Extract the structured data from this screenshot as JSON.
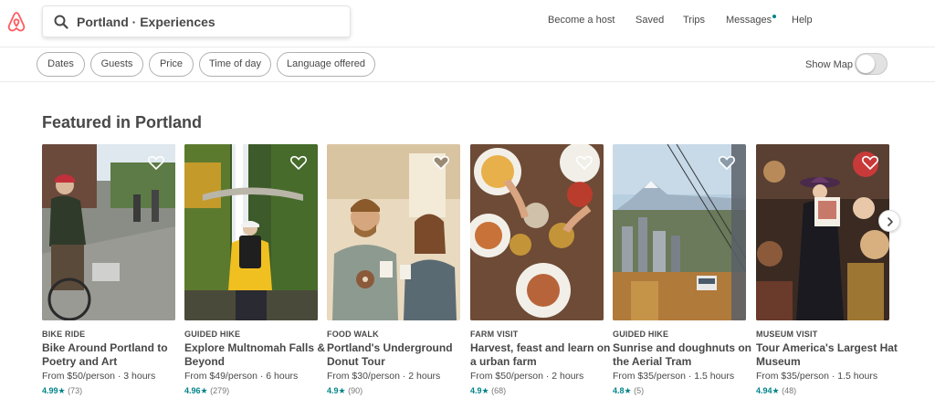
{
  "search": {
    "value": "Portland · Experiences"
  },
  "nav": {
    "become_host": "Become a host",
    "saved": "Saved",
    "trips": "Trips",
    "messages": "Messages",
    "help": "Help"
  },
  "filters": [
    "Dates",
    "Guests",
    "Price",
    "Time of day",
    "Language offered"
  ],
  "show_map": "Show Map",
  "section_title": "Featured in Portland",
  "cards": [
    {
      "category": "BIKE RIDE",
      "title": "Bike Around Portland to Poetry and Art",
      "price": "From $50/person · 3 hours",
      "score": "4.99",
      "star": "★",
      "count": "(73)"
    },
    {
      "category": "GUIDED HIKE",
      "title": "Explore Multnomah Falls & Beyond",
      "price": "From $49/person · 6 hours",
      "score": "4.96",
      "star": "★",
      "count": "(279)"
    },
    {
      "category": "FOOD WALK",
      "title": "Portland's Underground Donut Tour",
      "price": "From $30/person · 2 hours",
      "score": "4.9",
      "star": "★",
      "count": "(90)"
    },
    {
      "category": "FARM VISIT",
      "title": "Harvest, feast and learn on a urban farm",
      "price": "From $50/person · 2 hours",
      "score": "4.9",
      "star": "★",
      "count": "(68)"
    },
    {
      "category": "GUIDED HIKE",
      "title": "Sunrise and doughnuts on the Aerial Tram",
      "price": "From $35/person · 1.5 hours",
      "score": "4.8",
      "star": "★",
      "count": "(5)"
    },
    {
      "category": "MUSEUM VISIT",
      "title": "Tour America's Largest Hat Museum",
      "price": "From $35/person · 1.5 hours",
      "score": "4.94",
      "star": "★",
      "count": "(48)"
    }
  ],
  "colors": {
    "brand": "#FF5A5F",
    "accent": "#008489",
    "text": "#484848"
  },
  "icons": {
    "logo": "airbnb-logo",
    "search": "search-icon",
    "heart": "heart-icon",
    "next": "chevron-right-icon"
  }
}
